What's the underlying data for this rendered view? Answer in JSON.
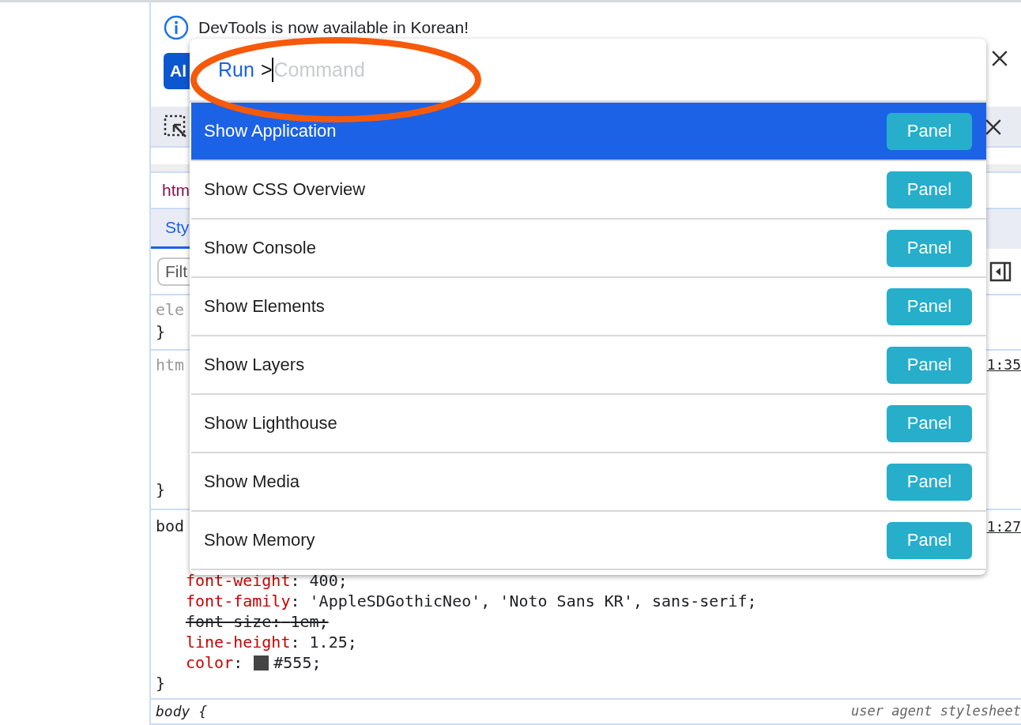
{
  "notice": {
    "message": "DevTools is now available in Korean!",
    "button": "Al"
  },
  "breadcrumb": "htm",
  "tabs": [
    {
      "label": "Sty",
      "selected": true
    }
  ],
  "filter": {
    "placeholder": "Filt"
  },
  "rules": [
    {
      "selector": "ele",
      "dim": true,
      "close": "}"
    },
    {
      "selector": "htm",
      "dim": true,
      "source": "1:35",
      "close": "}"
    },
    {
      "selector": "bod",
      "dim": false,
      "source": "1:27",
      "declarations": [
        {
          "name": "font-weight",
          "punct": ":",
          "value": "400;",
          "overridden": false
        },
        {
          "name": "font-family",
          "punct": ":",
          "value": "'AppleSDGothicNeo', 'Noto Sans KR', sans-serif;",
          "overridden": false
        },
        {
          "name": "font-size",
          "punct": ":",
          "value": "1em;",
          "overridden": true
        },
        {
          "name": "line-height",
          "punct": ":",
          "value": "1.25;",
          "overridden": false
        },
        {
          "name": "color",
          "punct": ":",
          "value": "#555;",
          "color": "#444444",
          "overridden": false
        }
      ],
      "close": "}"
    },
    {
      "selector": "body {",
      "italic": true,
      "origin": "user agent stylesheet"
    }
  ],
  "command_menu": {
    "prefix": "Run",
    "prompt": ">",
    "placeholder": "Command",
    "items": [
      {
        "label": "Show Application",
        "badge": "Panel",
        "selected": true
      },
      {
        "label": "Show CSS Overview",
        "badge": "Panel",
        "selected": false
      },
      {
        "label": "Show Console",
        "badge": "Panel",
        "selected": false
      },
      {
        "label": "Show Elements",
        "badge": "Panel",
        "selected": false
      },
      {
        "label": "Show Layers",
        "badge": "Panel",
        "selected": false
      },
      {
        "label": "Show Lighthouse",
        "badge": "Panel",
        "selected": false
      },
      {
        "label": "Show Media",
        "badge": "Panel",
        "selected": false
      },
      {
        "label": "Show Memory",
        "badge": "Panel",
        "selected": false
      }
    ]
  }
}
